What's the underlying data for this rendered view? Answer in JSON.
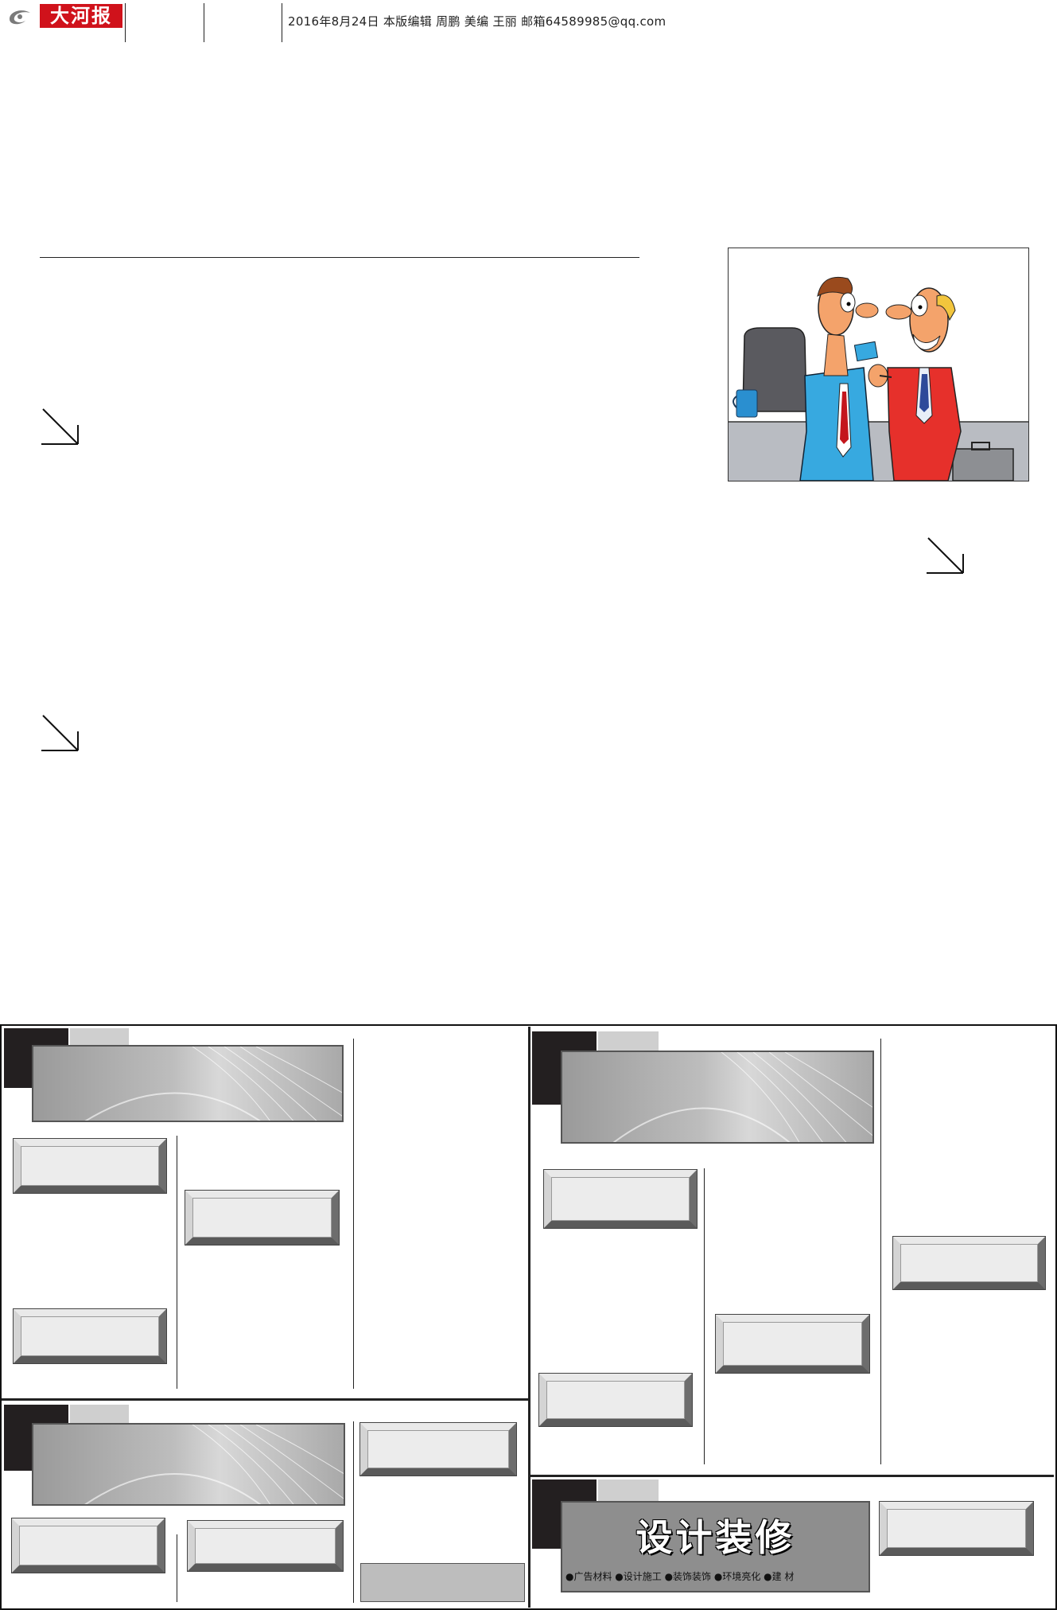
{
  "header": {
    "logo_text": "大河报",
    "info": "2016年8月24日   本版编辑 周鹏  美编 王丽   邮箱64589985@qq.com"
  },
  "ads": {
    "design_banner_title": "设计装修",
    "design_banner_services": "●广告材料  ●设计施工  ●装饰装饰  ●环境亮化  ●建    材"
  },
  "colors": {
    "logo_red": "#d0121b",
    "block_black": "#231f20",
    "block_grey": "#cfcfcf"
  }
}
